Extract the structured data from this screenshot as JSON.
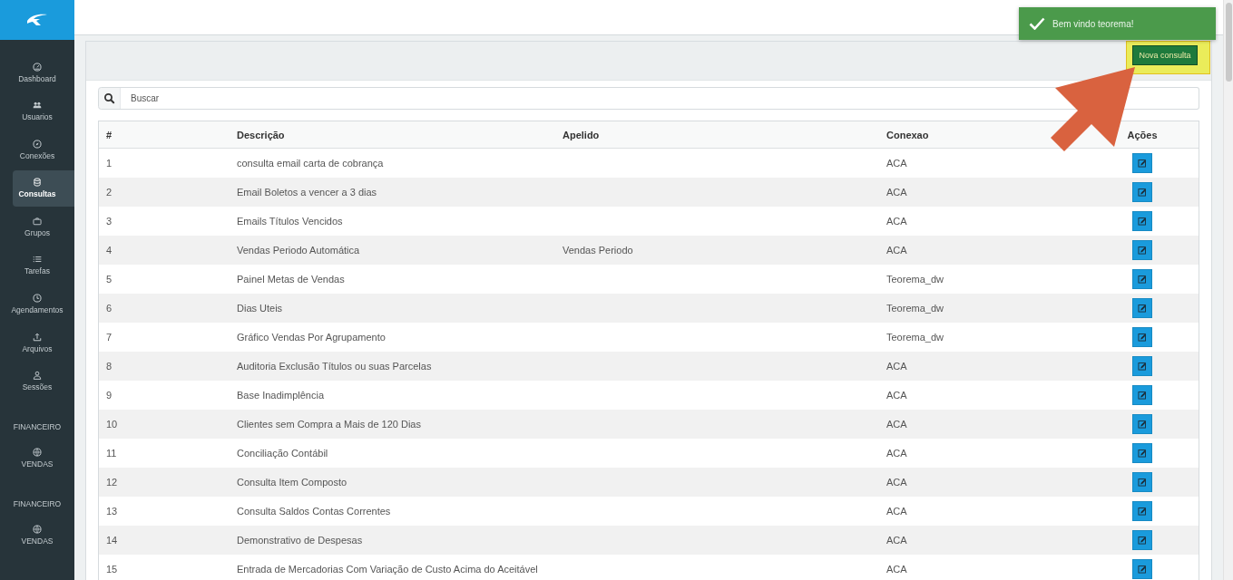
{
  "sidebar": {
    "nav": [
      {
        "label": "Dashboard",
        "selected": false
      },
      {
        "label": "Usuarios",
        "selected": false
      },
      {
        "label": "Conexões",
        "selected": false
      },
      {
        "label": "Consultas",
        "selected": true
      },
      {
        "label": "Grupos",
        "selected": false
      },
      {
        "label": "Tarefas",
        "selected": false
      },
      {
        "label": "Agendamentos",
        "selected": false
      },
      {
        "label": "Arquivos",
        "selected": false
      },
      {
        "label": "Sessões",
        "selected": false
      }
    ],
    "sections": [
      {
        "title": "FINANCEIRO",
        "items": [
          {
            "label": "VENDAS",
            "selected": false
          }
        ]
      },
      {
        "title": "FINANCEIRO",
        "items": [
          {
            "label": "VENDAS",
            "selected": false
          }
        ]
      }
    ]
  },
  "toast": {
    "message": "Bem vindo teorema!"
  },
  "panel": {
    "new_button": {
      "label": "Nova consulta",
      "highlighted": true
    },
    "search": {
      "placeholder": "Buscar"
    },
    "table": {
      "columns": [
        "#",
        "Descrição",
        "Apelido",
        "Conexao",
        "Ações"
      ],
      "rows": [
        {
          "number": "1",
          "description": "consulta email carta de cobrança",
          "connection": "ACA"
        },
        {
          "number": "2",
          "description": "Email Boletos a vencer a 3 dias",
          "connection": "ACA"
        },
        {
          "number": "3",
          "description": "Emails Títulos Vencidos",
          "connection": "ACA"
        },
        {
          "number": "4",
          "description": "Vendas Periodo Automática",
          "alias": "Vendas Periodo",
          "connection": "ACA"
        },
        {
          "number": "5",
          "description": "Painel Metas de Vendas",
          "connection": "Teorema_dw"
        },
        {
          "number": "6",
          "description": "Dias Uteis",
          "connection": "Teorema_dw"
        },
        {
          "number": "7",
          "description": "Gráfico Vendas Por Agrupamento",
          "connection": "Teorema_dw"
        },
        {
          "number": "8",
          "description": "Auditoria Exclusão Títulos ou suas Parcelas",
          "connection": "ACA"
        },
        {
          "number": "9",
          "description": "Base Inadimplência",
          "connection": "ACA"
        },
        {
          "number": "10",
          "description": "Clientes sem Compra a Mais de 120 Dias",
          "connection": "ACA"
        },
        {
          "number": "11",
          "description": "Conciliação Contábil",
          "connection": "ACA"
        },
        {
          "number": "12",
          "description": "Consulta Item Composto",
          "connection": "ACA"
        },
        {
          "number": "13",
          "description": "Consulta Saldos Contas Correntes",
          "connection": "ACA"
        },
        {
          "number": "14",
          "description": "Demonstrativo de Despesas",
          "connection": "ACA"
        },
        {
          "number": "15",
          "description": "Entrada de Mercadorias Com Variação de Custo Acima do Aceitável",
          "connection": "ACA"
        }
      ]
    }
  }
}
